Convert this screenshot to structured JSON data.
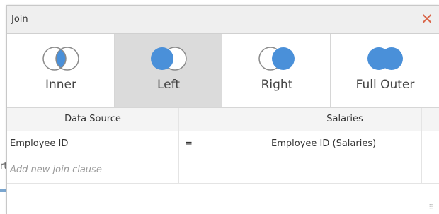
{
  "background": {
    "edge_text": "rt"
  },
  "dialog": {
    "title": "Join",
    "close_glyph": "✕"
  },
  "join_types": [
    {
      "id": "inner",
      "label": "Inner",
      "selected": false
    },
    {
      "id": "left",
      "label": "Left",
      "selected": true
    },
    {
      "id": "right",
      "label": "Right",
      "selected": false
    },
    {
      "id": "full-outer",
      "label": "Full Outer",
      "selected": false
    }
  ],
  "colors": {
    "accent": "#4a90d9",
    "close": "#d9664a",
    "selected_bg": "#dbdbdb"
  },
  "table": {
    "headers": [
      "Data Source",
      "",
      "Salaries",
      ""
    ],
    "rows": [
      {
        "left": "Employee ID",
        "op": "=",
        "right": "Employee ID (Salaries)"
      }
    ],
    "add_clause_placeholder": "Add new join clause"
  }
}
